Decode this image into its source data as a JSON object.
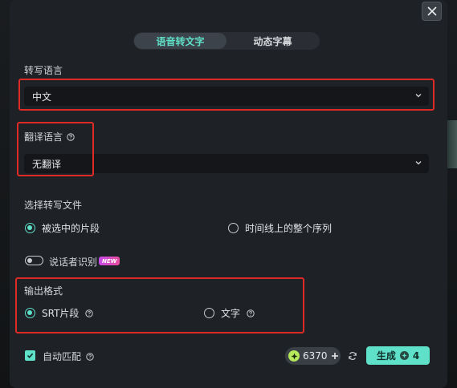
{
  "tabs": [
    {
      "label": "语音转文字",
      "active": true
    },
    {
      "label": "动态字幕",
      "active": false
    }
  ],
  "transcription_language": {
    "label": "转写语言",
    "value": "中文"
  },
  "translation_language": {
    "label": "翻译语言",
    "value": "无翻译"
  },
  "transcribe_file": {
    "label": "选择转写文件",
    "options": [
      "被选中的片段",
      "时间线上的整个序列"
    ],
    "selected": "被选中的片段"
  },
  "speaker_recognition": {
    "label": "说话者识别",
    "badge": "NEW",
    "enabled": false
  },
  "output_format": {
    "label": "输出格式",
    "options": [
      "SRT片段",
      "文字"
    ],
    "selected": "SRT片段"
  },
  "auto_match": {
    "label": "自动匹配",
    "checked": true
  },
  "credits": {
    "value": "6370"
  },
  "generate": {
    "label": "生成",
    "cost": "4"
  },
  "colors": {
    "accent": "#5fe0c8",
    "highlight_box": "#e02a25",
    "panel": "#1e2126"
  },
  "icons": [
    "close-icon",
    "chevron-down-icon",
    "help-icon",
    "plus-icon",
    "refresh-icon",
    "check-icon",
    "coin-icon"
  ]
}
